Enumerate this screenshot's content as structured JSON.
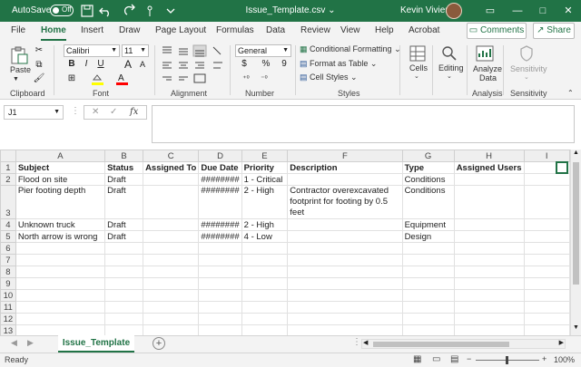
{
  "titlebar": {
    "autosave_label": "AutoSave",
    "autosave_state": "Off",
    "document_title": "Issue_Template.csv",
    "chevron": "⌄",
    "user_name": "Kevin Vivien",
    "search_icon": "search-icon",
    "minimize": "—",
    "restore": "□",
    "close": "✕"
  },
  "tabs": [
    "File",
    "Home",
    "Insert",
    "Draw",
    "Page Layout",
    "Formulas",
    "Data",
    "Review",
    "View",
    "Help",
    "Acrobat"
  ],
  "active_tab": "Home",
  "comments_label": "Comments",
  "share_label": "Share",
  "ribbon": {
    "clipboard": {
      "label": "Clipboard",
      "paste": "Paste"
    },
    "font": {
      "label": "Font",
      "name": "Calibri",
      "size": "11",
      "bold": "B",
      "italic": "I",
      "underline": "U",
      "grow": "A",
      "shrink": "A",
      "fill_color": "#ffff00",
      "font_color": "#ff0000"
    },
    "alignment": {
      "label": "Alignment"
    },
    "number": {
      "label": "Number",
      "format": "General",
      "currency": "$",
      "percent": "%",
      "comma": "9"
    },
    "styles": {
      "label": "Styles",
      "conditional": "Conditional Formatting",
      "format_table": "Format as Table",
      "cell_styles": "Cell Styles"
    },
    "cells": {
      "label": "Cells"
    },
    "editing": {
      "label": "Editing"
    },
    "analysis": {
      "label": "Analysis",
      "analyze_line1": "Analyze",
      "analyze_line2": "Data"
    },
    "sensitivity": {
      "label": "Sensitivity",
      "button": "Sensitivity"
    }
  },
  "formula_bar": {
    "name_box": "J1",
    "fx": "fx",
    "cancel": "✕",
    "enter": "✓",
    "value": ""
  },
  "sheet": {
    "columns": [
      "A",
      "B",
      "C",
      "D",
      "E",
      "F",
      "G",
      "H",
      "I"
    ],
    "rows": [
      {
        "n": "1",
        "A": "Subject",
        "B": "Status",
        "C": "Assigned To",
        "D": "Due Date",
        "E": "Priority",
        "F": "Description",
        "G": "Type",
        "H": "Assigned Users",
        "I": ""
      },
      {
        "n": "2",
        "A": "Flood on site",
        "B": "Draft",
        "C": "",
        "D": "########",
        "E": "1 - Critical",
        "F": "",
        "G": "Conditions",
        "H": "",
        "I": ""
      },
      {
        "n": "3",
        "A": "Pier footing depth",
        "B": "Draft",
        "C": "",
        "D": "########",
        "E": "2 - High",
        "F": "Contractor overexcavated footprint for footing by 0.5 feet",
        "G": "Conditions",
        "H": "",
        "I": ""
      },
      {
        "n": "4",
        "A": "Unknown truck",
        "B": "Draft",
        "C": "",
        "D": "########",
        "E": "2 - High",
        "F": "",
        "G": "Equipment",
        "H": "",
        "I": ""
      },
      {
        "n": "5",
        "A": "North arrow is wrong",
        "B": "Draft",
        "C": "",
        "D": "########",
        "E": "4 - Low",
        "F": "",
        "G": "Design",
        "H": "",
        "I": ""
      },
      {
        "n": "6"
      },
      {
        "n": "7"
      },
      {
        "n": "8"
      },
      {
        "n": "9"
      },
      {
        "n": "10"
      },
      {
        "n": "11"
      },
      {
        "n": "12"
      },
      {
        "n": "13"
      }
    ]
  },
  "sheet_tab": "Issue_Template",
  "add_sheet": "+",
  "status": {
    "ready": "Ready",
    "zoom": "100%",
    "zoom_minus": "−",
    "zoom_plus": "+"
  }
}
